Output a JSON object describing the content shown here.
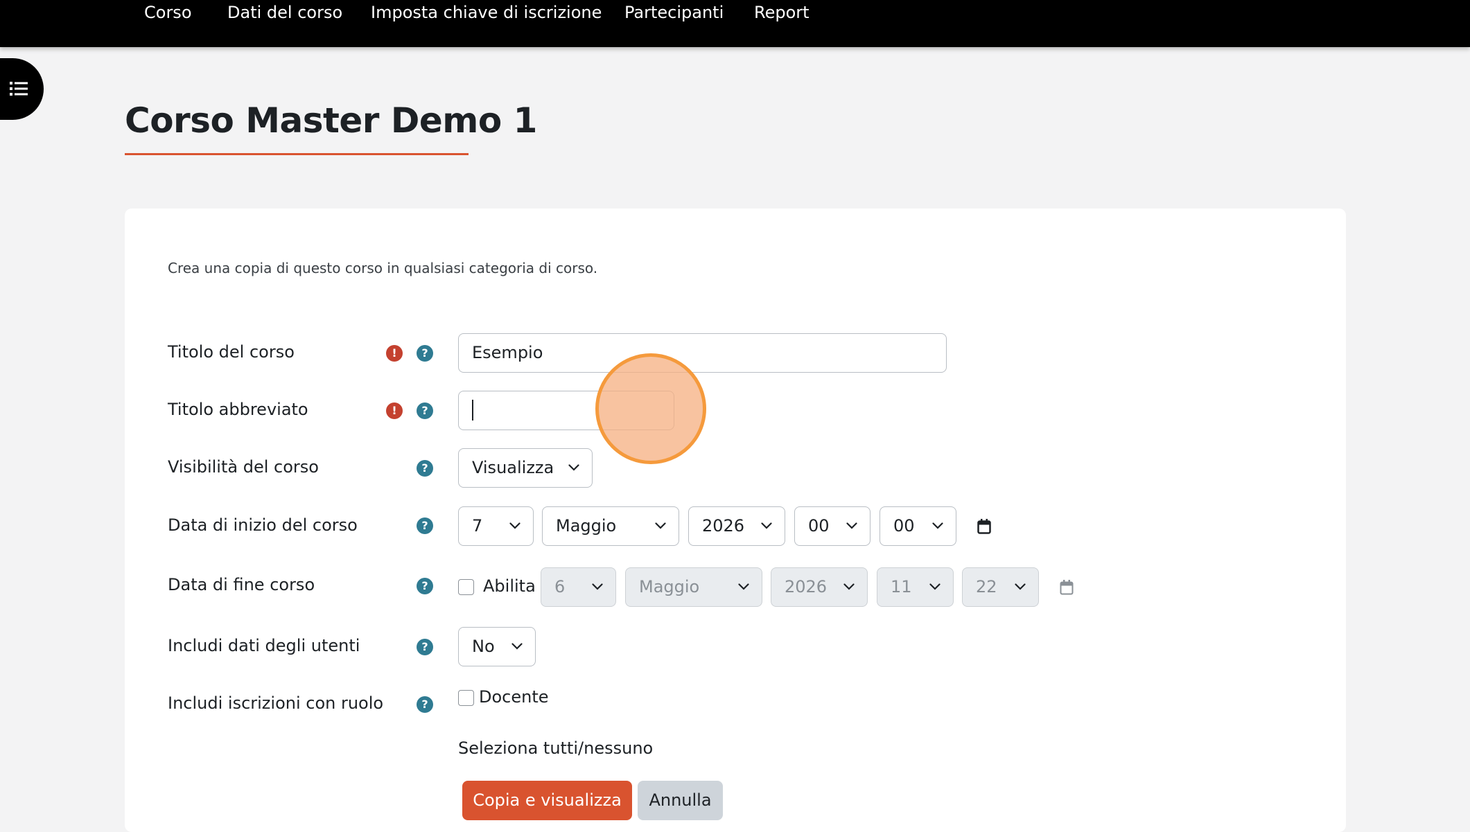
{
  "nav": {
    "items": [
      "Corso",
      "Dati del corso",
      "Imposta chiave di iscrizione",
      "Partecipanti",
      "Report"
    ]
  },
  "page": {
    "title": "Corso Master Demo 1"
  },
  "form": {
    "intro": "Crea una copia di questo corso in qualsiasi categoria di corso.",
    "course_title": {
      "label": "Titolo del corso",
      "value": "Esempio"
    },
    "short_title": {
      "label": "Titolo abbreviato",
      "value": ""
    },
    "visibility": {
      "label": "Visibilità del corso",
      "value": "Visualizza"
    },
    "start_date": {
      "label": "Data di inizio del corso",
      "day": "7",
      "month": "Maggio",
      "year": "2026",
      "hour": "00",
      "minute": "00"
    },
    "end_date": {
      "label": "Data di fine corso",
      "enable_label": "Abilita",
      "day": "6",
      "month": "Maggio",
      "year": "2026",
      "hour": "11",
      "minute": "22"
    },
    "user_data": {
      "label": "Includi dati degli utenti",
      "value": "No"
    },
    "role_enrolments": {
      "label": "Includi iscrizioni con ruolo",
      "role": "Docente"
    },
    "select_all": "Seleziona tutti/nessuno",
    "submit_label": "Copia e visualizza",
    "cancel_label": "Annulla"
  },
  "colors": {
    "accent": "#d9532f",
    "help": "#2f7b92",
    "required": "#c4412f",
    "nav_bg": "#000000"
  },
  "icons": {
    "index": "list-icon",
    "required": "exclamation-icon",
    "help": "question-icon",
    "select": "chevron-down-icon",
    "calendar": "calendar-icon"
  }
}
